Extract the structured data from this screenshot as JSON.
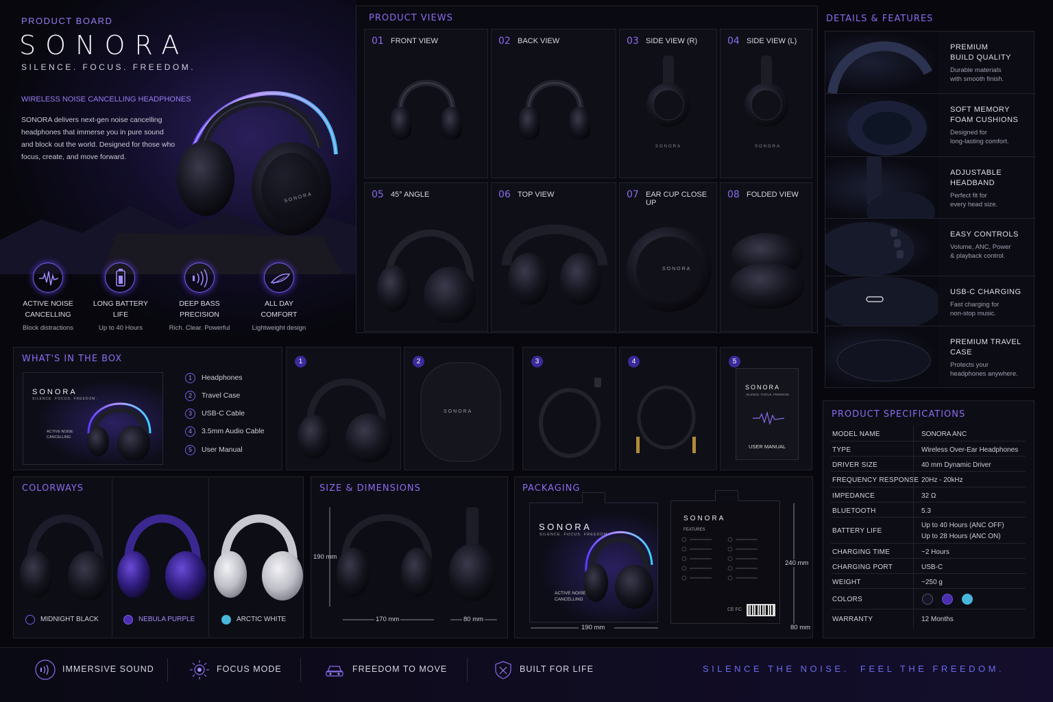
{
  "brand": {
    "board_label": "PRODUCT BOARD",
    "name": "SONORA",
    "tagline": "SILENCE. FOCUS. FREEDOM.",
    "subtitle": "WIRELESS NOISE CANCELLING HEADPHONES",
    "description": "SONORA delivers next-gen noise cancelling headphones that immerse you in pure sound and block out the world. Designed for those who focus, create, and move forward.",
    "product_mark": "SONORA"
  },
  "key_features": [
    {
      "icon": "soundwave-icon",
      "title_line1": "ACTIVE NOISE",
      "title_line2": "CANCELLING",
      "sub": "Block distractions"
    },
    {
      "icon": "battery-icon",
      "title_line1": "LONG BATTERY",
      "title_line2": "LIFE",
      "sub": "Up to 40 Hours"
    },
    {
      "icon": "bass-icon",
      "title_line1": "DEEP BASS",
      "title_line2": "PRECISION",
      "sub": "Rich. Clear. Powerful"
    },
    {
      "icon": "feather-icon",
      "title_line1": "ALL DAY",
      "title_line2": "COMFORT",
      "sub": "Lightweight design"
    }
  ],
  "product_views": {
    "title": "PRODUCT VIEWS",
    "items": [
      {
        "num": "01",
        "label": "FRONT VIEW"
      },
      {
        "num": "02",
        "label": "BACK VIEW"
      },
      {
        "num": "03",
        "label": "SIDE VIEW (R)"
      },
      {
        "num": "04",
        "label": "SIDE VIEW (L)"
      },
      {
        "num": "05",
        "label": "45° ANGLE"
      },
      {
        "num": "06",
        "label": "TOP VIEW"
      },
      {
        "num": "07",
        "label": "EAR CUP CLOSE UP"
      },
      {
        "num": "08",
        "label": "FOLDED VIEW"
      }
    ]
  },
  "details": {
    "title": "DETAILS & FEATURES",
    "items": [
      {
        "title_line1": "PREMIUM",
        "title_line2": "BUILD QUALITY",
        "desc_line1": "Durable materials",
        "desc_line2": "with smooth finish."
      },
      {
        "title_line1": "SOFT MEMORY",
        "title_line2": "FOAM CUSHIONS",
        "desc_line1": "Designed for",
        "desc_line2": "long-lasting comfort."
      },
      {
        "title_line1": "ADJUSTABLE",
        "title_line2": "HEADBAND",
        "desc_line1": "Perfect fit for",
        "desc_line2": "every head size."
      },
      {
        "title_line1": "EASY CONTROLS",
        "title_line2": "",
        "desc_line1": "Volume, ANC, Power",
        "desc_line2": "& playback control."
      },
      {
        "title_line1": "USB-C CHARGING",
        "title_line2": "",
        "desc_line1": "Fast charging for",
        "desc_line2": "non-stop music."
      },
      {
        "title_line1": "PREMIUM TRAVEL",
        "title_line2": "CASE",
        "desc_line1": "Protects your",
        "desc_line2": "headphones anywhere."
      }
    ]
  },
  "in_the_box": {
    "title": "WHAT'S IN THE BOX",
    "box_brand": "SONORA",
    "box_tagline": "SILENCE. FOCUS. FREEDOM.",
    "box_anc_line1": "ACTIVE NOISE",
    "box_anc_line2": "CANCELLING",
    "items": [
      {
        "num": "1",
        "label": "Headphones"
      },
      {
        "num": "2",
        "label": "Travel Case"
      },
      {
        "num": "3",
        "label": "USB-C Cable"
      },
      {
        "num": "4",
        "label": "3.5mm Audio Cable"
      },
      {
        "num": "5",
        "label": "User Manual"
      }
    ],
    "case_mark": "SONORA",
    "manual_brand": "SONORA",
    "manual_tagline": "SILENCE. FOCUS. FREEDOM.",
    "manual_label": "USER MANUAL"
  },
  "colorways": {
    "title": "COLORWAYS",
    "items": [
      {
        "name": "MIDNIGHT BLACK",
        "color": "#14142a"
      },
      {
        "name": "NEBULA PURPLE",
        "color": "#4a2fb0"
      },
      {
        "name": "ARCTIC WHITE",
        "color": "#49b6dc"
      }
    ]
  },
  "size": {
    "title": "SIZE & DIMENSIONS",
    "height": "190 mm",
    "width": "170 mm",
    "depth": "80 mm"
  },
  "packaging": {
    "title": "PACKAGING",
    "front_brand": "SONORA",
    "front_tagline": "SILENCE. FOCUS. FREEDOM.",
    "front_anc_line1": "ACTIVE NOISE",
    "front_anc_line2": "CANCELLING",
    "back_brand": "SONORA",
    "back_features": "FEATURES",
    "back_marks": "CE FC",
    "height": "240 mm",
    "width": "190 mm",
    "depth": "80 mm"
  },
  "specs": {
    "title": "PRODUCT SPECIFICATIONS",
    "rows": [
      {
        "k": "MODEL NAME",
        "v": "SONORA ANC"
      },
      {
        "k": "TYPE",
        "v": "Wireless Over-Ear Headphones"
      },
      {
        "k": "DRIVER SIZE",
        "v": "40 mm Dynamic Driver"
      },
      {
        "k": "FREQUENCY RESPONSE",
        "v": "20Hz - 20kHz"
      },
      {
        "k": "IMPEDANCE",
        "v": "32 Ω"
      },
      {
        "k": "BLUETOOTH",
        "v": "5.3"
      },
      {
        "k": "BATTERY LIFE",
        "v": "Up to 40 Hours (ANC OFF)",
        "v2": "Up to 28 Hours (ANC ON)"
      },
      {
        "k": "CHARGING TIME",
        "v": "~2 Hours"
      },
      {
        "k": "CHARGING PORT",
        "v": "USB-C"
      },
      {
        "k": "WEIGHT",
        "v": "~250 g"
      },
      {
        "k": "COLORS",
        "v": ""
      },
      {
        "k": "WARRANTY",
        "v": "12 Months"
      }
    ],
    "color_swatches": [
      "#14142a",
      "#4a2fb0",
      "#49b6dc"
    ]
  },
  "footer": {
    "items": [
      {
        "icon": "sound-icon",
        "label": "IMMERSIVE SOUND"
      },
      {
        "icon": "focus-icon",
        "label": "FOCUS MODE"
      },
      {
        "icon": "car-icon",
        "label": "FREEDOM TO MOVE"
      },
      {
        "icon": "shield-icon",
        "label": "BUILT FOR LIFE"
      }
    ],
    "slogan": "SILENCE THE NOISE.  FEEL THE FREEDOM."
  }
}
